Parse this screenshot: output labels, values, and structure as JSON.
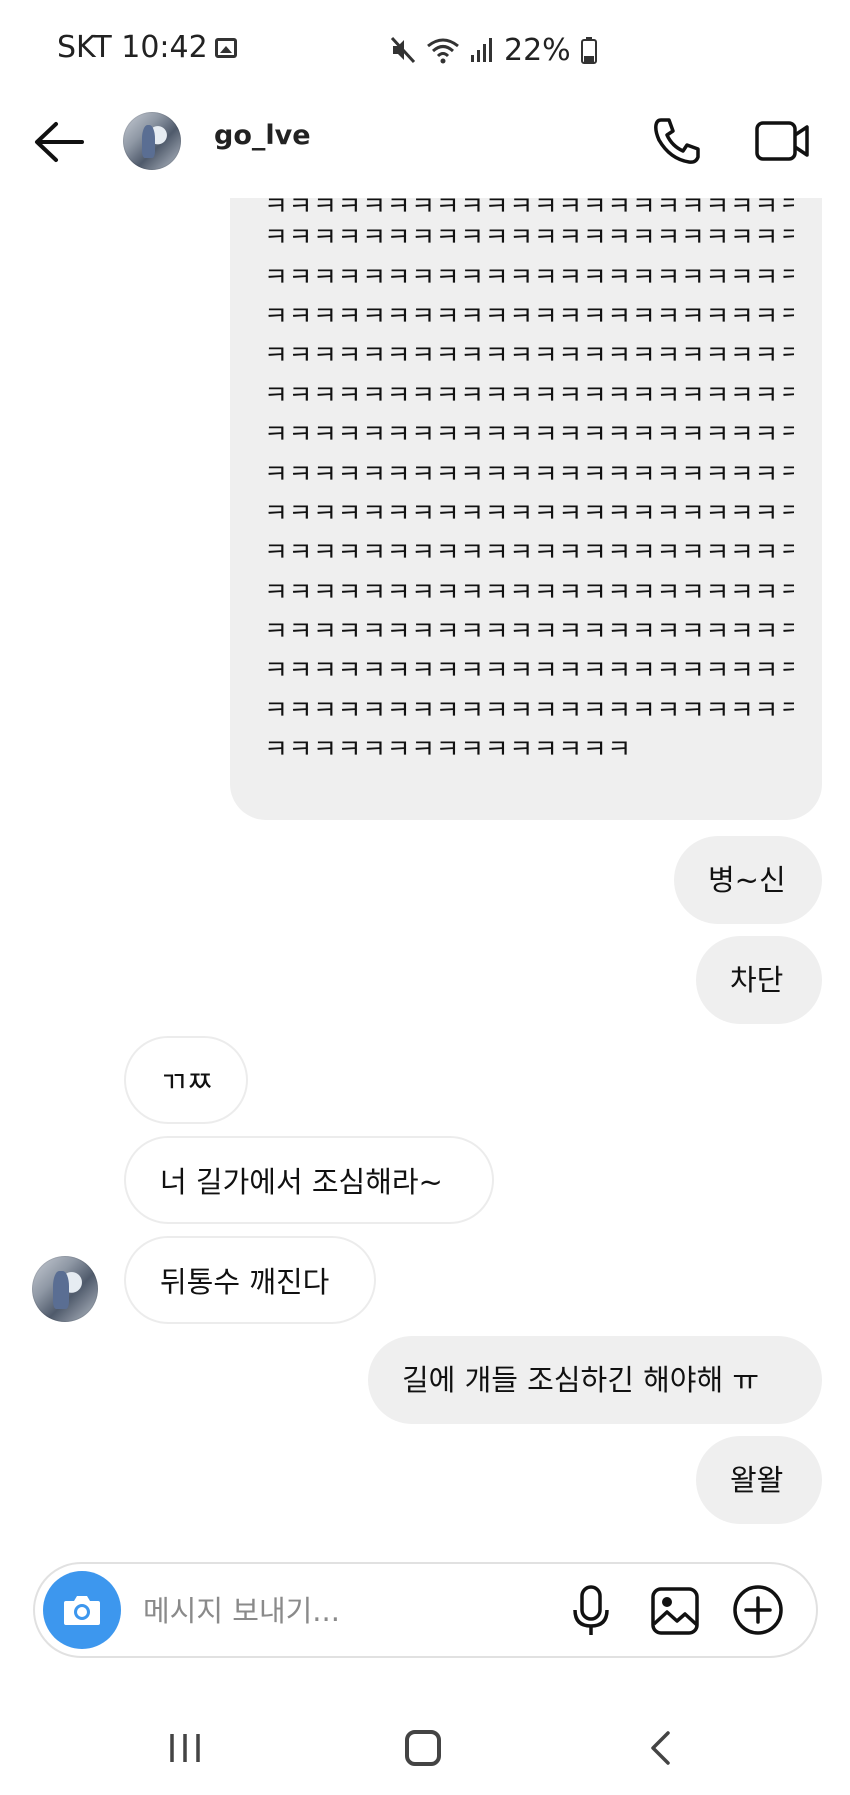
{
  "status_bar": {
    "carrier_time": "SKT 10:42",
    "battery": "22%",
    "icons": [
      "gallery-icon",
      "mute-icon",
      "wifi-icon",
      "signal-icon",
      "battery-icon"
    ]
  },
  "header": {
    "username": "go_lve",
    "icons": [
      "back-arrow-icon",
      "avatar",
      "phone-icon",
      "video-camera-icon"
    ]
  },
  "messages": {
    "long_message_lines": [
      "ㅋㅋㅋㅋㅋㅋㅋㅋㅋㅋㅋㅋㅋㅋㅋㅋㅋㅋㅋㅋㅋㅋㅋㅋㅋㅋㅋㅋ",
      "ㅋㅋㅋㅋㅋㅋㅋㅋㅋㅋㅋㅋㅋㅋㅋㅋㅋㅋㅋㅋㅋㅋㅋㅋㅋㅋㅋㅋ",
      "ㅋㅋㅋㅋㅋㅋㅋㅋㅋㅋㅋㅋㅋㅋㅋㅋㅋㅋㅋㅋㅋㅋㅋㅋㅋㅋㅋㅋ",
      "ㅋㅋㅋㅋㅋㅋㅋㅋㅋㅋㅋㅋㅋㅋㅋㅋㅋㅋㅋㅋㅋㅋㅋㅋㅋㅋㅋㅋ",
      "ㅋㅋㅋㅋㅋㅋㅋㅋㅋㅋㅋㅋㅋㅋㅋㅋㅋㅋㅋㅋㅋㅋㅋㅋㅋㅋㅋㅋ",
      "ㅋㅋㅋㅋㅋㅋㅋㅋㅋㅋㅋㅋㅋㅋㅋㅋㅋㅋㅋㅋㅋㅋㅋㅋㅋㅋㅋㅋ",
      "ㅋㅋㅋㅋㅋㅋㅋㅋㅋㅋㅋㅋㅋㅋㅋㅋㅋㅋㅋㅋㅋㅋㅋㅋㅋㅋㅋㅋ",
      "ㅋㅋㅋㅋㅋㅋㅋㅋㅋㅋㅋㅋㅋㅋㅋㅋㅋㅋㅋㅋㅋㅋㅋㅋㅋㅋㅋㅋ",
      "ㅋㅋㅋㅋㅋㅋㅋㅋㅋㅋㅋㅋㅋㅋㅋㅋㅋㅋㅋㅋㅋㅋㅋㅋㅋㅋㅋㅋ",
      "ㅋㅋㅋㅋㅋㅋㅋㅋㅋㅋㅋㅋㅋㅋㅋㅋㅋㅋㅋㅋㅋㅋㅋㅋㅋㅋㅋㅋ",
      "ㅋㅋㅋㅋㅋㅋㅋㅋㅋㅋㅋㅋㅋㅋㅋㅋㅋㅋㅋㅋㅋㅋㅋㅋㅋㅋㅋㅋ",
      "ㅋㅋㅋㅋㅋㅋㅋㅋㅋㅋㅋㅋㅋㅋㅋㅋㅋㅋㅋㅋㅋㅋㅋㅋㅋㅋㅋㅋ",
      "ㅋㅋㅋㅋㅋㅋㅋㅋㅋㅋㅋㅋㅋㅋㅋㅋㅋㅋㅋㅋㅋㅋㅋㅋㅋㅋㅋㅋ",
      "ㅋㅋㅋㅋㅋㅋㅋㅋㅋㅋㅋㅋㅋㅋㅋㅋㅋㅋㅋㅋㅋㅋㅋㅋㅋㅋㅋㅋ",
      "ㅋㅋㅋㅋㅋㅋㅋㅋㅋㅋㅋㅋㅋㅋㅋ"
    ],
    "m1": "병~신",
    "m2": "차단",
    "m3": "ㄲㅉ",
    "m4": "너 길가에서 조심해라~",
    "m5": "뒤통수 깨진다",
    "m6": "길에 개들 조심하긴 해야해 ㅠ",
    "m7": "왈왈"
  },
  "composer": {
    "placeholder": "메시지 보내기...",
    "value": "",
    "icons": [
      "camera-icon",
      "microphone-icon",
      "image-icon",
      "plus-circle-icon"
    ],
    "camera_color": "#3d97ee"
  },
  "nav_bar": {
    "icons": [
      "recent-apps-icon",
      "home-icon",
      "back-icon"
    ]
  }
}
